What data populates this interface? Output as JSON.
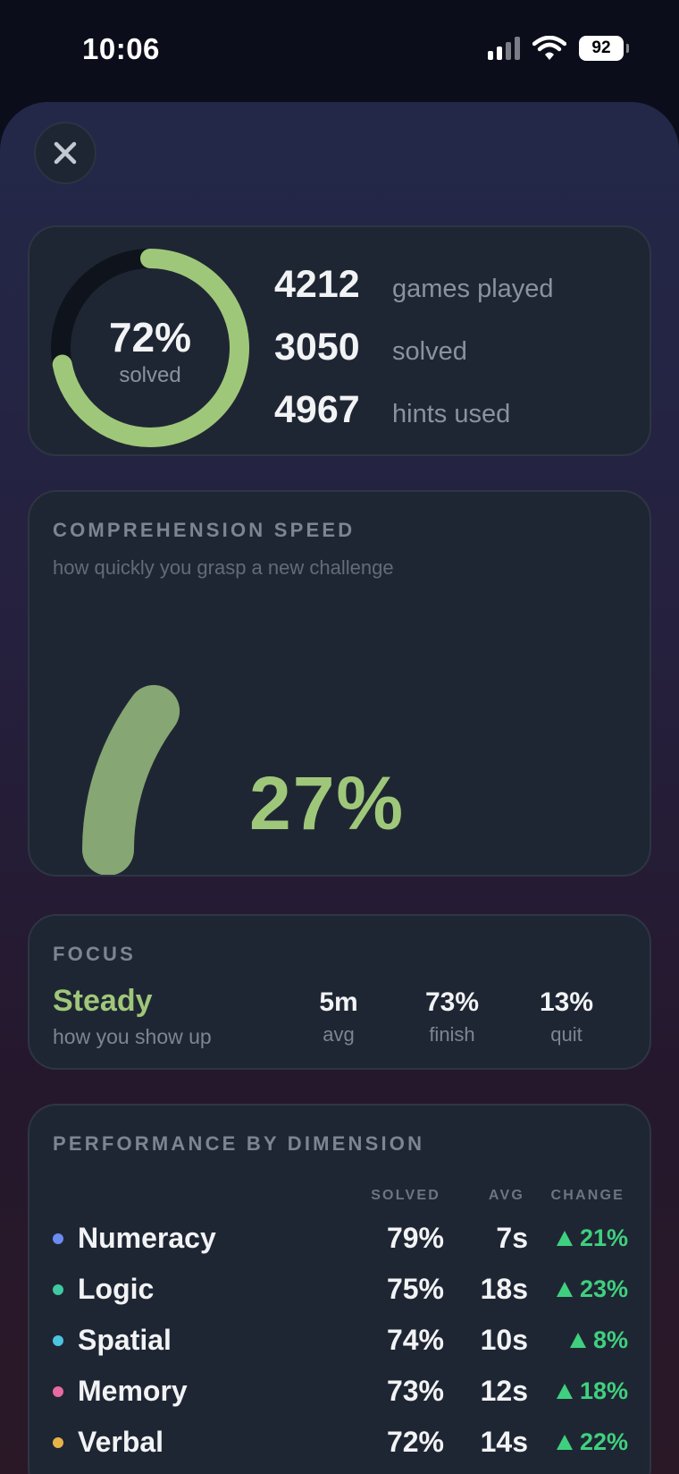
{
  "status_bar": {
    "time": "10:06",
    "battery": "92"
  },
  "summary": {
    "ring_percent": "72%",
    "ring_label": "solved",
    "ring_fraction": 0.72,
    "stats": [
      {
        "value": "4212",
        "label": "games played"
      },
      {
        "value": "3050",
        "label": "solved"
      },
      {
        "value": "4967",
        "label": "hints used"
      }
    ]
  },
  "speed": {
    "title": "COMPREHENSION SPEED",
    "subtitle": "how quickly you grasp a new challenge",
    "value": "27%",
    "fraction": 0.27
  },
  "focus": {
    "title": "FOCUS",
    "word": "Steady",
    "subtitle": "how you show up",
    "stats": [
      {
        "value": "5m",
        "label": "avg"
      },
      {
        "value": "73%",
        "label": "finish"
      },
      {
        "value": "13%",
        "label": "quit"
      }
    ]
  },
  "performance": {
    "title": "PERFORMANCE BY DIMENSION",
    "headers": {
      "solved": "SOLVED",
      "avg": "AVG",
      "change": "CHANGE"
    },
    "rows": [
      {
        "name": "Numeracy",
        "solved": "79%",
        "avg": "7s",
        "change": "21%",
        "color": "#6b8cf0"
      },
      {
        "name": "Logic",
        "solved": "75%",
        "avg": "18s",
        "change": "23%",
        "color": "#3fc9a0"
      },
      {
        "name": "Spatial",
        "solved": "74%",
        "avg": "10s",
        "change": "8%",
        "color": "#4cc3e0"
      },
      {
        "name": "Memory",
        "solved": "73%",
        "avg": "12s",
        "change": "18%",
        "color": "#e86aa0"
      },
      {
        "name": "Verbal",
        "solved": "72%",
        "avg": "14s",
        "change": "22%",
        "color": "#e8b24a"
      }
    ]
  },
  "colors": {
    "accent_green": "#9fc77a",
    "change_green": "#3fd07f",
    "card_bg": "#1f2633"
  }
}
